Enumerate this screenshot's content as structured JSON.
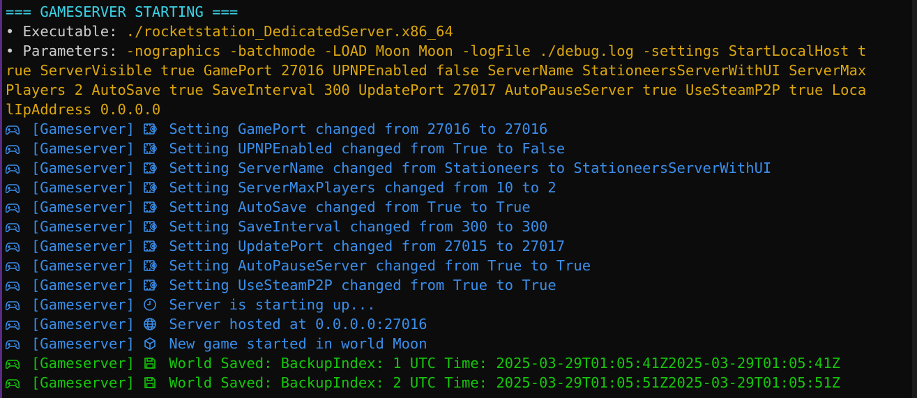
{
  "header": "=== GAMESERVER STARTING ===",
  "executable": {
    "label": "• Executable: ",
    "value": "./rocketstation_DedicatedServer.x86_64"
  },
  "parameters": {
    "label": "• Parameters: ",
    "lines": [
      "-nographics -batchmode -LOAD Moon Moon -logFile ./debug.log -settings StartLocalHost t",
      "rue ServerVisible true GamePort 27016 UPNPEnabled false ServerName StationeersServerWithUI ServerMax",
      "Players 2 AutoSave true SaveInterval 300 UpdatePort 27017 AutoPauseServer true UseSteamP2P true Loca",
      "lIpAddress 0.0.0.0"
    ]
  },
  "prefix": "[Gameserver]",
  "settings": [
    {
      "icon": "settings-icon",
      "text": "Setting GamePort changed from 27016 to 27016"
    },
    {
      "icon": "settings-icon",
      "text": "Setting UPNPEnabled changed from True to False"
    },
    {
      "icon": "settings-icon",
      "text": "Setting ServerName changed from Stationeers to StationeersServerWithUI"
    },
    {
      "icon": "settings-icon",
      "text": "Setting ServerMaxPlayers changed from 10 to 2"
    },
    {
      "icon": "settings-icon",
      "text": "Setting AutoSave changed from True to True"
    },
    {
      "icon": "settings-icon",
      "text": "Setting SaveInterval changed from 300 to 300"
    },
    {
      "icon": "settings-icon",
      "text": "Setting UpdatePort changed from 27015 to 27017"
    },
    {
      "icon": "settings-icon",
      "text": "Setting AutoPauseServer changed from True to True"
    },
    {
      "icon": "settings-icon",
      "text": "Setting UseSteamP2P changed from True to True"
    }
  ],
  "status": [
    {
      "icon": "clock-icon",
      "text": "Server is starting up..."
    },
    {
      "icon": "globe-icon",
      "text": "Server hosted at 0.0.0.0:27016"
    },
    {
      "icon": "cube-icon",
      "text": "New game started in world Moon"
    }
  ],
  "saves": [
    {
      "icon": "floppy-disk-icon",
      "text": "World Saved: BackupIndex: 1 UTC Time: 2025-03-29T01:05:41Z2025-03-29T01:05:41Z"
    },
    {
      "icon": "floppy-disk-icon",
      "text": "World Saved: BackupIndex: 2 UTC Time: 2025-03-29T01:05:51Z2025-03-29T01:05:51Z"
    }
  ],
  "colors": {
    "header": "#3ad4e8",
    "label": "#cccccc",
    "value": "#dba60e",
    "info": "#3b8eea",
    "success": "#16c60c",
    "background": "#0c0c0c"
  }
}
